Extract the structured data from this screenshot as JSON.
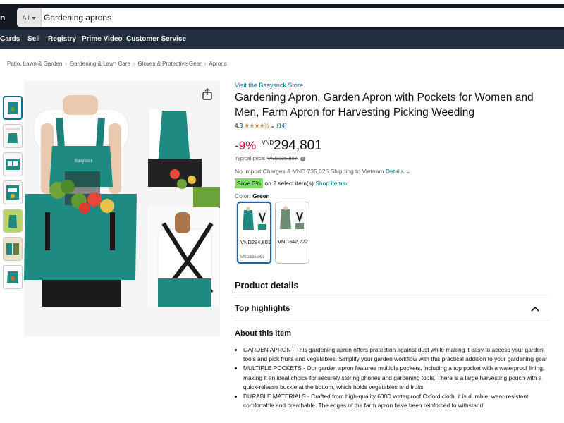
{
  "header": {
    "logo_fragment": "n",
    "search_category": "All",
    "search_value": "Gardening aprons"
  },
  "nav": [
    "Cards",
    "Sell",
    "Registry",
    "Prime Video",
    "Customer Service"
  ],
  "breadcrumb": [
    "Patio, Lawn & Garden",
    "Gardening & Lawn Care",
    "Gloves & Protective Gear",
    "Aprons"
  ],
  "product": {
    "store_link": "Visit the Basysnck Store",
    "title": "Gardening Apron, Garden Apron with Pockets for Women and Men, Farm Apron for Harvesting Picking Weeding",
    "rating_value": "4.3",
    "stars": "★★★★½",
    "rating_count": "(14)",
    "discount": "-9%",
    "currency": "VND",
    "price": "294,801",
    "typical_label": "Typical price:",
    "typical_price": "VND325,097",
    "shipping": "No Import Charges & VND 735,026 Shipping to Vietnam",
    "shipping_details": "Details",
    "save_badge": "Save 5%",
    "save_text": "on 2 select item(s)",
    "shop_items": "Shop items",
    "color_label": "Color:",
    "color_value": "Green",
    "swatches": [
      {
        "price": "VND294,801",
        "list_price": "VND325,097",
        "color": "#1f8a82"
      },
      {
        "price": "VND342,222",
        "list_price": "",
        "color": "#6e8d76"
      }
    ]
  },
  "sections": {
    "product_details": "Product details",
    "top_highlights": "Top highlights",
    "about": "About this item"
  },
  "bullets": [
    "GARDEN APRON - This gardening apron offers protection against dust while making it easy to access your garden tools and pick fruits and vegetables. Simplify your garden workflow with this practical addition to your gardening gear",
    "MULTIPLE POCKETS - Our garden apron features multiple pockets, including a top pocket with a waterproof lining, making it an ideal choice for securely storing phones and gardening tools. There is a large harvesting pouch with a quick-release buckle at the bottom, which holds vegetables and fruits",
    "DURABLE MATERIALS - Crafted from high-quality 600D waterproof Oxford cloth, it is durable, wear-resistant, comfortable and breathable. The edges of the farm apron have been reinforced to withstand"
  ],
  "images": {
    "apron_brand": "Basysnck",
    "apron_color": "#1f8a82"
  }
}
